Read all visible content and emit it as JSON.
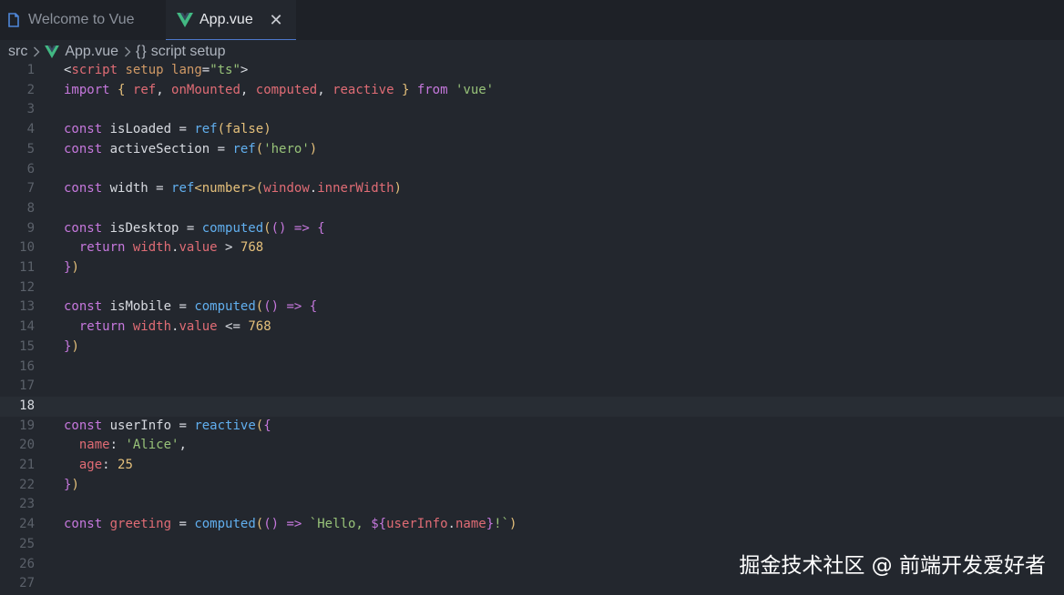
{
  "tabs": [
    {
      "label": "Welcome to Vue",
      "icon": "file-icon",
      "active": false
    },
    {
      "label": "App.vue",
      "icon": "vue-icon",
      "active": true,
      "close": "✕"
    }
  ],
  "breadcrumb": {
    "folder": "src",
    "file": "App.vue",
    "symbol_glyph": "{}",
    "symbol": "script setup"
  },
  "editor": {
    "current_line": 18,
    "lines": [
      {
        "n": "1",
        "tokens": [
          {
            "t": "<",
            "c": "default"
          },
          {
            "t": "script",
            "c": "tag"
          },
          {
            "t": " ",
            "c": "default"
          },
          {
            "t": "setup",
            "c": "attr"
          },
          {
            "t": " ",
            "c": "default"
          },
          {
            "t": "lang",
            "c": "attr"
          },
          {
            "t": "=",
            "c": "default"
          },
          {
            "t": "\"ts\"",
            "c": "string"
          },
          {
            "t": ">",
            "c": "default"
          }
        ]
      },
      {
        "n": "2",
        "tokens": [
          {
            "t": "import",
            "c": "keyword"
          },
          {
            "t": " ",
            "c": "default"
          },
          {
            "t": "{",
            "c": "bracket1"
          },
          {
            "t": " ",
            "c": "default"
          },
          {
            "t": "ref",
            "c": "variable"
          },
          {
            "t": ", ",
            "c": "default"
          },
          {
            "t": "onMounted",
            "c": "variable"
          },
          {
            "t": ", ",
            "c": "default"
          },
          {
            "t": "computed",
            "c": "variable"
          },
          {
            "t": ", ",
            "c": "default"
          },
          {
            "t": "reactive",
            "c": "variable"
          },
          {
            "t": " ",
            "c": "default"
          },
          {
            "t": "}",
            "c": "bracket1"
          },
          {
            "t": " ",
            "c": "default"
          },
          {
            "t": "from",
            "c": "keyword"
          },
          {
            "t": " ",
            "c": "default"
          },
          {
            "t": "'vue'",
            "c": "string"
          }
        ]
      },
      {
        "n": "3",
        "tokens": []
      },
      {
        "n": "4",
        "tokens": [
          {
            "t": "const",
            "c": "keyword"
          },
          {
            "t": " isLoaded = ",
            "c": "default"
          },
          {
            "t": "ref",
            "c": "function"
          },
          {
            "t": "(",
            "c": "bracket1"
          },
          {
            "t": "false",
            "c": "number"
          },
          {
            "t": ")",
            "c": "bracket1"
          }
        ]
      },
      {
        "n": "5",
        "tokens": [
          {
            "t": "const",
            "c": "keyword"
          },
          {
            "t": " activeSection = ",
            "c": "default"
          },
          {
            "t": "ref",
            "c": "function"
          },
          {
            "t": "(",
            "c": "bracket1"
          },
          {
            "t": "'hero'",
            "c": "string"
          },
          {
            "t": ")",
            "c": "bracket1"
          }
        ]
      },
      {
        "n": "6",
        "tokens": []
      },
      {
        "n": "7",
        "tokens": [
          {
            "t": "const",
            "c": "keyword"
          },
          {
            "t": " width = ",
            "c": "default"
          },
          {
            "t": "ref",
            "c": "function"
          },
          {
            "t": "<",
            "c": "bracket1"
          },
          {
            "t": "number",
            "c": "number"
          },
          {
            "t": ">",
            "c": "bracket1"
          },
          {
            "t": "(",
            "c": "bracket1"
          },
          {
            "t": "window",
            "c": "variable"
          },
          {
            "t": ".",
            "c": "default"
          },
          {
            "t": "innerWidth",
            "c": "variable"
          },
          {
            "t": ")",
            "c": "bracket1"
          }
        ]
      },
      {
        "n": "8",
        "tokens": []
      },
      {
        "n": "9",
        "tokens": [
          {
            "t": "const",
            "c": "keyword"
          },
          {
            "t": " isDesktop = ",
            "c": "default"
          },
          {
            "t": "computed",
            "c": "function"
          },
          {
            "t": "(",
            "c": "bracket1"
          },
          {
            "t": "()",
            "c": "bracket2"
          },
          {
            "t": " ",
            "c": "default"
          },
          {
            "t": "=>",
            "c": "keyword"
          },
          {
            "t": " ",
            "c": "default"
          },
          {
            "t": "{",
            "c": "bracket2"
          }
        ]
      },
      {
        "n": "10",
        "tokens": [
          {
            "t": "  ",
            "c": "default"
          },
          {
            "t": "return",
            "c": "keyword"
          },
          {
            "t": " ",
            "c": "default"
          },
          {
            "t": "width",
            "c": "variable"
          },
          {
            "t": ".",
            "c": "default"
          },
          {
            "t": "value",
            "c": "variable"
          },
          {
            "t": " > ",
            "c": "default"
          },
          {
            "t": "768",
            "c": "number"
          }
        ]
      },
      {
        "n": "11",
        "tokens": [
          {
            "t": "}",
            "c": "bracket2"
          },
          {
            "t": ")",
            "c": "bracket1"
          }
        ]
      },
      {
        "n": "12",
        "tokens": []
      },
      {
        "n": "13",
        "tokens": [
          {
            "t": "const",
            "c": "keyword"
          },
          {
            "t": " isMobile = ",
            "c": "default"
          },
          {
            "t": "computed",
            "c": "function"
          },
          {
            "t": "(",
            "c": "bracket1"
          },
          {
            "t": "()",
            "c": "bracket2"
          },
          {
            "t": " ",
            "c": "default"
          },
          {
            "t": "=>",
            "c": "keyword"
          },
          {
            "t": " ",
            "c": "default"
          },
          {
            "t": "{",
            "c": "bracket2"
          }
        ]
      },
      {
        "n": "14",
        "tokens": [
          {
            "t": "  ",
            "c": "default"
          },
          {
            "t": "return",
            "c": "keyword"
          },
          {
            "t": " ",
            "c": "default"
          },
          {
            "t": "width",
            "c": "variable"
          },
          {
            "t": ".",
            "c": "default"
          },
          {
            "t": "value",
            "c": "variable"
          },
          {
            "t": " <= ",
            "c": "default"
          },
          {
            "t": "768",
            "c": "number"
          }
        ]
      },
      {
        "n": "15",
        "tokens": [
          {
            "t": "}",
            "c": "bracket2"
          },
          {
            "t": ")",
            "c": "bracket1"
          }
        ]
      },
      {
        "n": "16",
        "tokens": []
      },
      {
        "n": "17",
        "tokens": []
      },
      {
        "n": "18",
        "tokens": []
      },
      {
        "n": "19",
        "tokens": [
          {
            "t": "const",
            "c": "keyword"
          },
          {
            "t": " userInfo = ",
            "c": "default"
          },
          {
            "t": "reactive",
            "c": "function"
          },
          {
            "t": "(",
            "c": "bracket1"
          },
          {
            "t": "{",
            "c": "bracket2"
          }
        ]
      },
      {
        "n": "20",
        "tokens": [
          {
            "t": "  ",
            "c": "default"
          },
          {
            "t": "name",
            "c": "variable"
          },
          {
            "t": ": ",
            "c": "default"
          },
          {
            "t": "'Alice'",
            "c": "string"
          },
          {
            "t": ",",
            "c": "default"
          }
        ]
      },
      {
        "n": "21",
        "tokens": [
          {
            "t": "  ",
            "c": "default"
          },
          {
            "t": "age",
            "c": "variable"
          },
          {
            "t": ": ",
            "c": "default"
          },
          {
            "t": "25",
            "c": "number"
          }
        ]
      },
      {
        "n": "22",
        "tokens": [
          {
            "t": "}",
            "c": "bracket2"
          },
          {
            "t": ")",
            "c": "bracket1"
          }
        ]
      },
      {
        "n": "23",
        "tokens": []
      },
      {
        "n": "24",
        "tokens": [
          {
            "t": "const",
            "c": "keyword"
          },
          {
            "t": " ",
            "c": "default"
          },
          {
            "t": "greeting",
            "c": "variable"
          },
          {
            "t": " = ",
            "c": "default"
          },
          {
            "t": "computed",
            "c": "function"
          },
          {
            "t": "(",
            "c": "bracket1"
          },
          {
            "t": "()",
            "c": "bracket2"
          },
          {
            "t": " ",
            "c": "default"
          },
          {
            "t": "=>",
            "c": "keyword"
          },
          {
            "t": " ",
            "c": "default"
          },
          {
            "t": "`Hello, ",
            "c": "string"
          },
          {
            "t": "${",
            "c": "keyword"
          },
          {
            "t": "userInfo",
            "c": "variable"
          },
          {
            "t": ".",
            "c": "default"
          },
          {
            "t": "name",
            "c": "variable"
          },
          {
            "t": "}",
            "c": "keyword"
          },
          {
            "t": "!`",
            "c": "string"
          },
          {
            "t": ")",
            "c": "bracket1"
          }
        ]
      },
      {
        "n": "25",
        "tokens": []
      },
      {
        "n": "26",
        "tokens": []
      },
      {
        "n": "27",
        "tokens": []
      }
    ]
  },
  "watermark": "掘金技术社区 @ 前端开发爱好者",
  "colors": {
    "background": "#23272e",
    "tabbar_background": "#1e2127",
    "active_line": "#282d34",
    "keyword": "#c678dd",
    "function": "#61afef",
    "variable": "#e06c75",
    "string": "#98c379",
    "number": "#e5c07b",
    "vue_green": "#42b883",
    "file_icon_blue": "#4f86d8"
  }
}
